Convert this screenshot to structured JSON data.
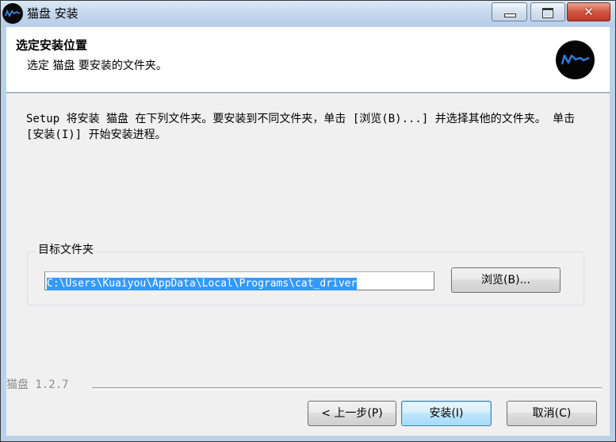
{
  "window": {
    "title": "猫盘 安装",
    "controls": {
      "minimize_glyph": "—",
      "maximize_glyph": "□",
      "close_glyph": "✕"
    }
  },
  "header": {
    "title": "选定安装位置",
    "subtitle": "选定 猫盘 要安装的文件夹。",
    "logo_icon": "catpan-logo-icon"
  },
  "content": {
    "description": "Setup 将安装 猫盘 在下列文件夹。要安装到不同文件夹，单击 [浏览(B)...] 并选择其他的文件夹。 单击 [安装(I)] 开始安装进程。",
    "destination_group_label": "目标文件夹",
    "destination_path": "C:\\Users\\Kuaiyou\\AppData\\Local\\Programs\\cat_driver",
    "browse_label": "浏览(B)..."
  },
  "footer": {
    "version": "猫盘 1.2.7",
    "back_label": "< 上一步(P)",
    "install_label": "安装(I)",
    "cancel_label": "取消(C)"
  },
  "colors": {
    "titlebar": "#c3d6ec",
    "close_button": "#c0392b",
    "selection": "#3399ff",
    "panel": "#f0f0f0"
  }
}
